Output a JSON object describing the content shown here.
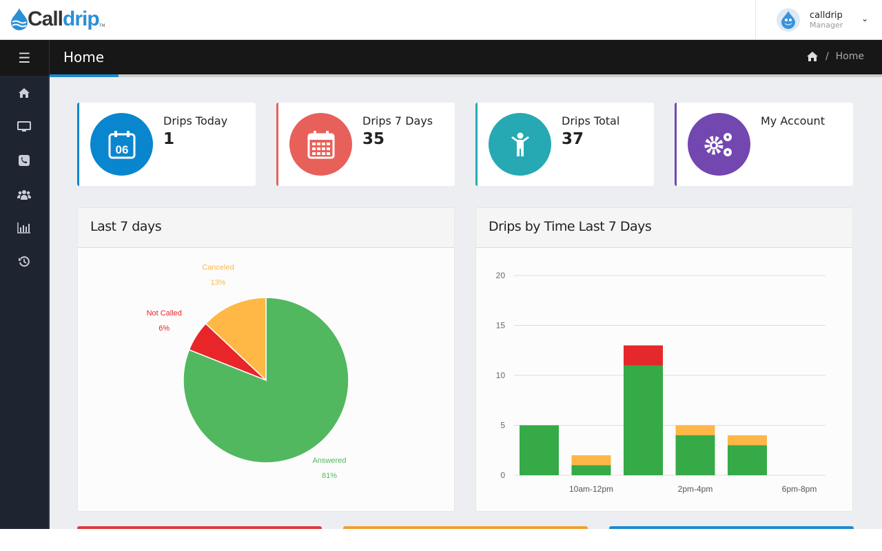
{
  "app": {
    "logo_part1": "Call",
    "logo_part2": "drip",
    "logo_tm": "TM"
  },
  "user": {
    "name": "calldrip",
    "role": "Manager"
  },
  "header": {
    "title": "Home",
    "breadcrumb": [
      "Home"
    ]
  },
  "sidebar": {
    "items": [
      {
        "icon": "home-icon"
      },
      {
        "icon": "monitor-icon"
      },
      {
        "icon": "phone-icon"
      },
      {
        "icon": "users-icon"
      },
      {
        "icon": "bar-chart-icon"
      },
      {
        "icon": "history-icon"
      }
    ]
  },
  "stats": [
    {
      "label": "Drips Today",
      "value": "1",
      "icon": "calendar-day-icon",
      "icon_text": "06",
      "color": "#0a86cf"
    },
    {
      "label": "Drips 7 Days",
      "value": "35",
      "icon": "calendar-icon",
      "color": "#e8605a"
    },
    {
      "label": "Drips Total",
      "value": "37",
      "icon": "person-icon",
      "color": "#26a9b3"
    },
    {
      "label": "My Account",
      "value": "",
      "icon": "gears-icon",
      "color": "#7247b0"
    }
  ],
  "panels": {
    "pie_title": "Last 7 days",
    "bar_title": "Drips by Time Last 7 Days"
  },
  "bottom_strips": [
    "#e03a3a",
    "#f0a030",
    "#1b8bd0"
  ],
  "chart_data": [
    {
      "type": "pie",
      "title": "Last 7 days",
      "slices": [
        {
          "label": "Answered",
          "value": 81,
          "display": "81%",
          "color": "#52b85f"
        },
        {
          "label": "Not Called",
          "value": 6,
          "display": "6%",
          "color": "#e8262a"
        },
        {
          "label": "Canceled",
          "value": 13,
          "display": "13%",
          "color": "#ffb846"
        }
      ]
    },
    {
      "type": "bar",
      "stacked": true,
      "title": "Drips by Time Last 7 Days",
      "categories": [
        "",
        "10am-12pm",
        "",
        "2pm-4pm",
        "",
        "6pm-8pm"
      ],
      "series": [
        {
          "values": [
            5,
            1,
            11,
            4,
            3,
            0
          ],
          "color": "#35aa47"
        },
        {
          "values": [
            0,
            0,
            2,
            0,
            0,
            0
          ],
          "color": "#e5282a"
        },
        {
          "values": [
            0,
            1,
            0,
            1,
            1,
            0
          ],
          "color": "#ffb648"
        }
      ],
      "ylim": [
        0,
        20
      ],
      "yticks": [
        0,
        5,
        10,
        15,
        20
      ],
      "grid": true
    }
  ]
}
